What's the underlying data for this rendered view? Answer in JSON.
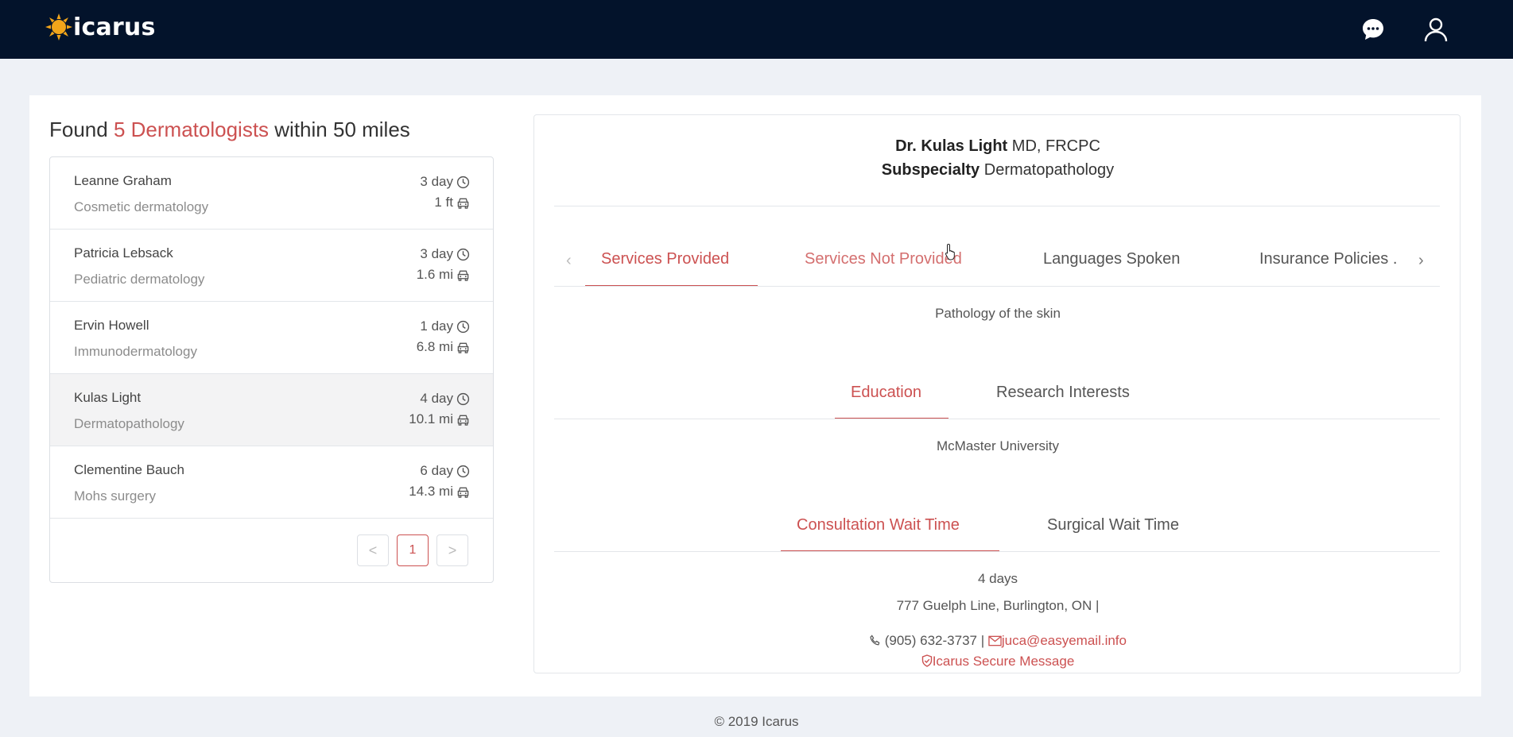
{
  "app": {
    "name": "icarus",
    "brand_color": "#cc5151",
    "header_bg": "#03132b"
  },
  "header": {
    "chat_icon": "chat-bubble-icon",
    "user_icon": "user-icon"
  },
  "search": {
    "prefix": "Found",
    "count_label": "5 Dermatologists",
    "suffix": "within 50 miles"
  },
  "results": [
    {
      "name": "Leanne Graham",
      "specialty": "Cosmetic dermatology",
      "wait": "3 day",
      "distance": "1 ft"
    },
    {
      "name": "Patricia Lebsack",
      "specialty": "Pediatric dermatology",
      "wait": "3 day",
      "distance": "1.6 mi"
    },
    {
      "name": "Ervin Howell",
      "specialty": "Immunodermatology",
      "wait": "1 day",
      "distance": "6.8 mi"
    },
    {
      "name": "Kulas Light",
      "specialty": "Dermatopathology",
      "wait": "4 day",
      "distance": "10.1 mi",
      "selected": true
    },
    {
      "name": "Clementine Bauch",
      "specialty": "Mohs surgery",
      "wait": "6 day",
      "distance": "14.3 mi"
    }
  ],
  "pagination": {
    "prev": "<",
    "current": "1",
    "next": ">"
  },
  "doctor": {
    "name": "Dr. Kulas Light",
    "credentials": "MD, FRCPC",
    "subspecialty_label": "Subspecialty",
    "subspecialty": "Dermatopathology",
    "service_tabs": [
      "Services Provided",
      "Services Not Provided",
      "Languages Spoken",
      "Insurance Policies"
    ],
    "insurance_tab_display": "Insurance Policies .",
    "service_content": "Pathology of the skin",
    "edu_tabs": [
      "Education",
      "Research Interests"
    ],
    "edu_content": "McMaster University",
    "wait_tabs": [
      "Consultation Wait Time",
      "Surgical Wait Time"
    ],
    "wait_content": "4 days",
    "address": "777 Guelph Line, Burlington, ON |",
    "phone": "(905) 632-3737 |",
    "email": "juca@easyemail.info",
    "secure_message": "Icarus Secure Message"
  },
  "footer": {
    "copyright": "© 2019 Icarus"
  }
}
